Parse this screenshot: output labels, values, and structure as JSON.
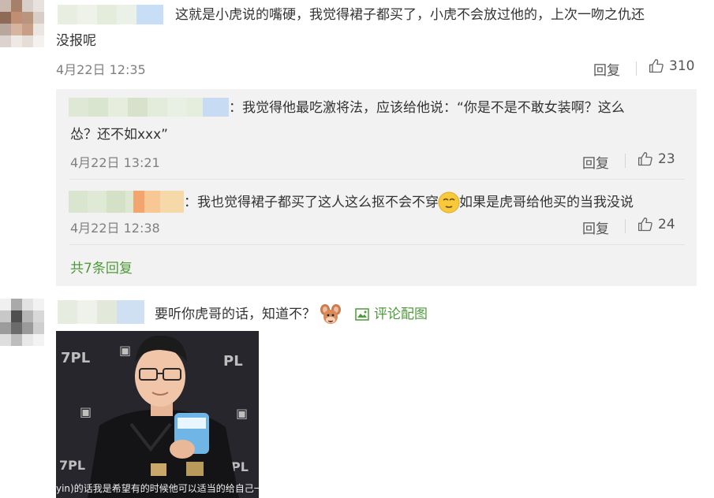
{
  "comments": [
    {
      "text": "这就是小虎说的嘴硬，我觉得裙子都买了，小虎不会放过他的，上次一吻之仇还没报呢",
      "line1": "这就是小虎说的嘴硬，我觉得裙子都买了，小虎不会放过他的，上次一吻之仇还",
      "line2": "没报呢",
      "time": "4月22日 12:35",
      "reply_label": "回复",
      "likes": "310"
    },
    {
      "text": "要听你虎哥的话，知道不？",
      "image_link": "评论配图",
      "image_caption": "yin)的话我是希望有的时候他可以适当的给自己一"
    }
  ],
  "replies": [
    {
      "line1": "：我觉得他最吃激将法，应该给他说：“你是不是不敢女装啊？这么",
      "line2": "怂？还不如xxx”",
      "time": "4月22日 13:21",
      "reply_label": "回复",
      "likes": "23"
    },
    {
      "before_emoji": "：我也觉得裙子都买了这人这么抠不会不穿",
      "after_emoji": "如果是虎哥给他买的当我没说",
      "time": "4月22日 12:38",
      "reply_label": "回复",
      "likes": "24"
    }
  ],
  "more_replies": "共7条回复",
  "icons": [
    "thumbs-up-icon",
    "image-icon",
    "emoji-icon"
  ],
  "colors": {
    "link": "#4e9a3a",
    "reply_bg": "#f2f2f2",
    "meta": "#808080"
  }
}
